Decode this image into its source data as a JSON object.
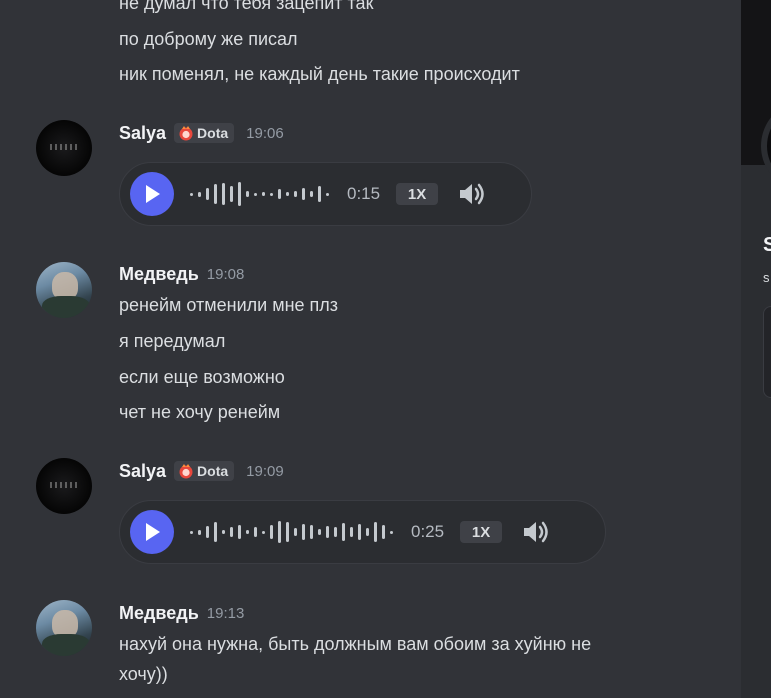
{
  "colors": {
    "accent": "#5865f2",
    "background": "#313338",
    "text": "#dbdee1",
    "muted": "#949ba4"
  },
  "top_lines": [
    "не думал что тебя зацепит так",
    "по доброму же писал",
    "ник поменял, не каждый день такие происходит"
  ],
  "messages": [
    {
      "author": "Salya",
      "tag": "Dota",
      "time": "19:06",
      "voice": {
        "duration": "0:15",
        "speed": "1X"
      }
    },
    {
      "author": "Медведь",
      "time": "19:08",
      "lines": [
        "ренейм отменили мне плз",
        "я передумал",
        "если еще возможно",
        "чет не хочу ренейм"
      ]
    },
    {
      "author": "Salya",
      "tag": "Dota",
      "time": "19:09",
      "voice": {
        "duration": "0:25",
        "speed": "1X"
      }
    },
    {
      "author": "Медведь",
      "time": "19:13",
      "lines": [
        "нахуй она нужна, быть должным вам обоим за хуйню не",
        "хочу))"
      ]
    }
  ],
  "profile_panel": {
    "name": "S",
    "sub": "s"
  }
}
